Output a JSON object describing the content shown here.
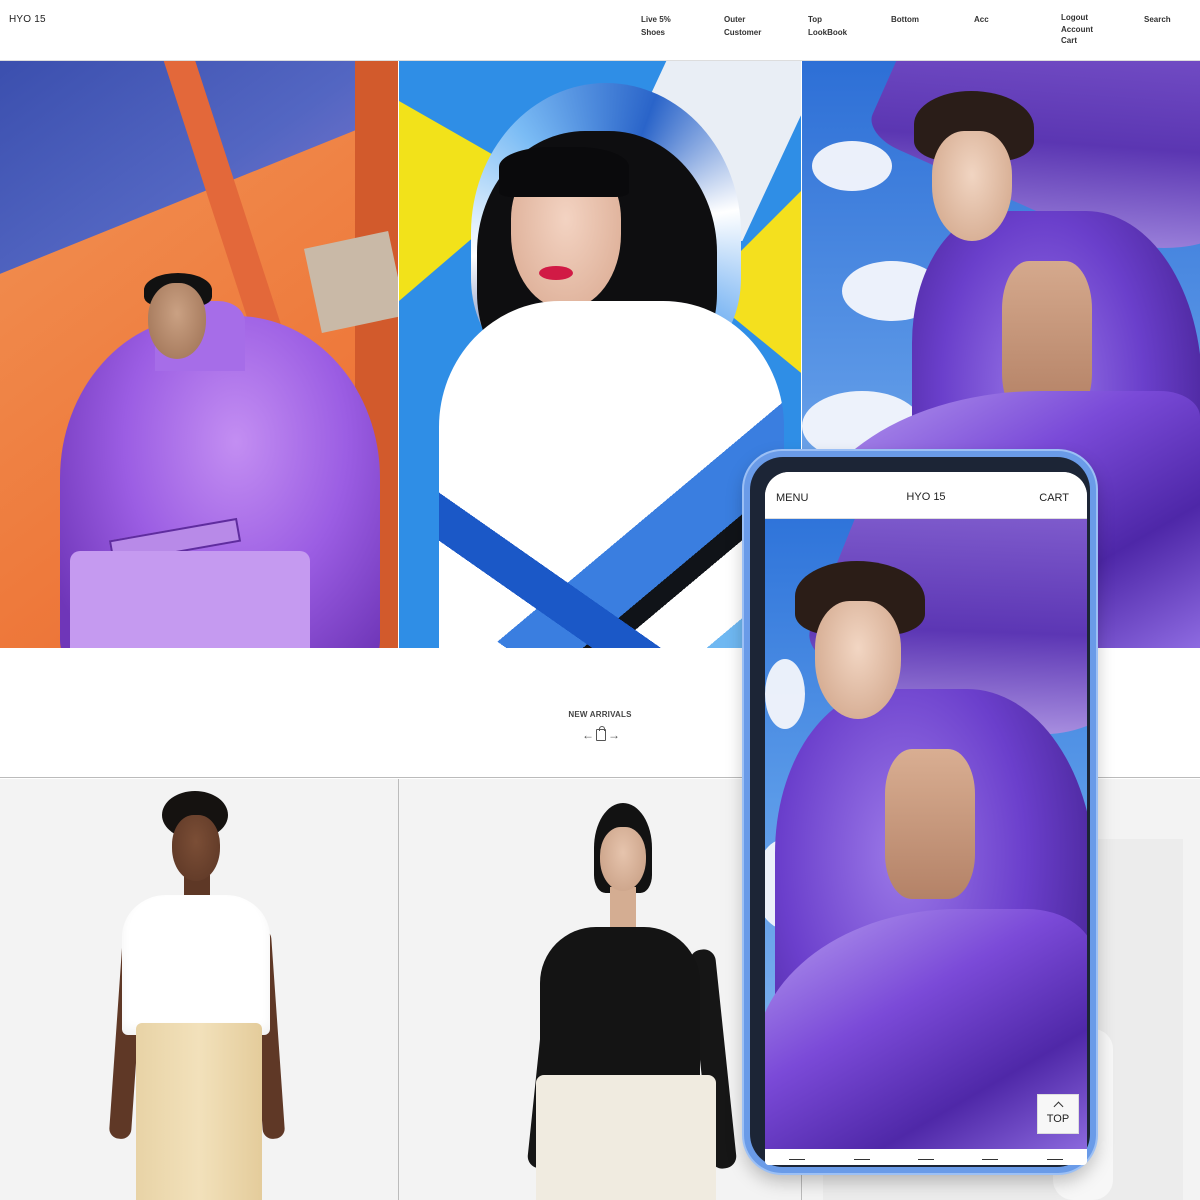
{
  "header": {
    "brand": "HYO 15",
    "nav": [
      {
        "line1": "Live 5%",
        "line2": "Shoes"
      },
      {
        "line1": "Outer",
        "line2": "Customer"
      },
      {
        "line1": "Top",
        "line2": "LookBook"
      },
      {
        "line1": "Bottom",
        "line2": ""
      },
      {
        "line1": "Acc",
        "line2": ""
      }
    ],
    "util": [
      "Logout",
      "Account",
      "Cart"
    ],
    "search": "Search"
  },
  "arrivals": {
    "title": "NEW ARRIVALS",
    "prev": "←",
    "next": "→"
  },
  "mobile": {
    "menu": "MENU",
    "brand": "HYO 15",
    "cart": "CART",
    "top_button": "TOP"
  },
  "colors": {
    "phone_frame": "#6a9be8",
    "accent_purple": "#7b4ad8",
    "sky_blue": "#2f74da"
  }
}
